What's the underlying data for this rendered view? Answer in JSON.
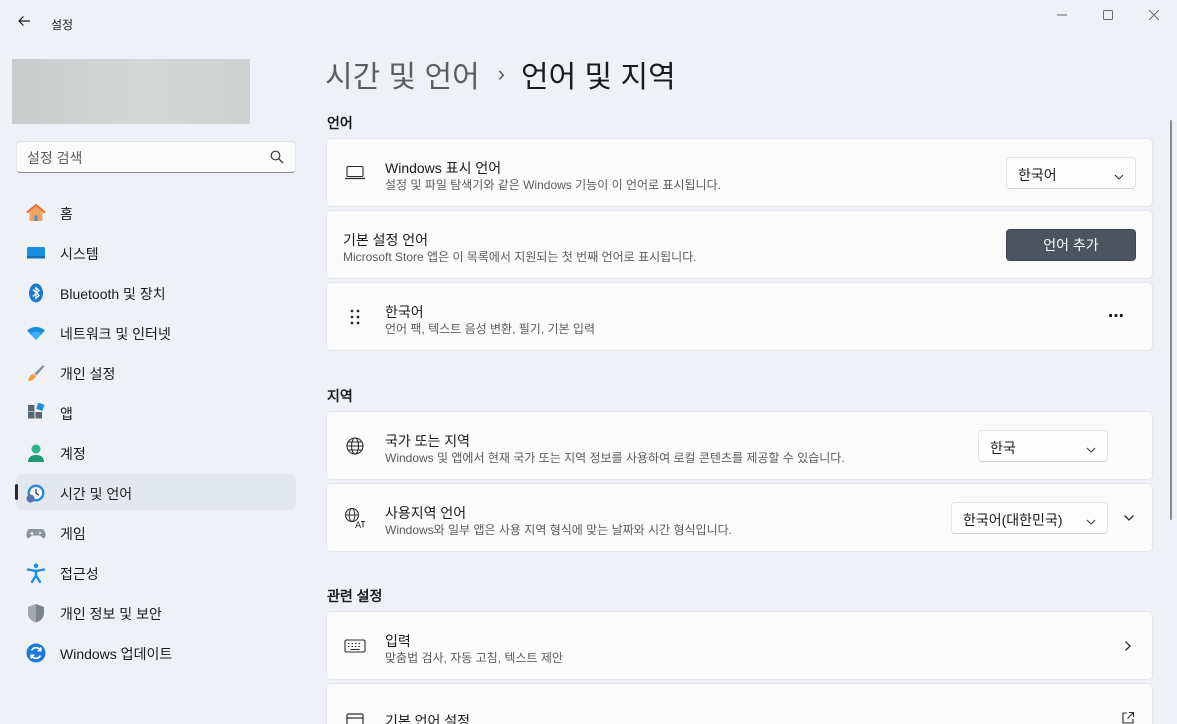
{
  "window": {
    "app_title": "설정",
    "icons": {
      "back": "back-arrow-icon",
      "minimize": "minimize-icon",
      "maximize": "maximize-icon",
      "close": "close-icon"
    }
  },
  "sidebar": {
    "search_placeholder": "설정 검색",
    "items": [
      {
        "label": "홈",
        "icon": "home-icon",
        "active": false
      },
      {
        "label": "시스템",
        "icon": "system-icon",
        "active": false
      },
      {
        "label": "Bluetooth 및 장치",
        "icon": "bluetooth-icon",
        "active": false
      },
      {
        "label": "네트워크 및 인터넷",
        "icon": "wifi-icon",
        "active": false
      },
      {
        "label": "개인 설정",
        "icon": "brush-icon",
        "active": false
      },
      {
        "label": "앱",
        "icon": "apps-icon",
        "active": false
      },
      {
        "label": "계정",
        "icon": "account-icon",
        "active": false
      },
      {
        "label": "시간 및 언어",
        "icon": "time-language-icon",
        "active": true
      },
      {
        "label": "게임",
        "icon": "gamepad-icon",
        "active": false
      },
      {
        "label": "접근성",
        "icon": "accessibility-icon",
        "active": false
      },
      {
        "label": "개인 정보 및 보안",
        "icon": "shield-icon",
        "active": false
      },
      {
        "label": "Windows 업데이트",
        "icon": "windows-update-icon",
        "active": false
      }
    ]
  },
  "breadcrumb": {
    "parent": "시간 및 언어",
    "separator": "›",
    "current": "언어 및 지역"
  },
  "sections": {
    "language": "언어",
    "region": "지역",
    "related": "관련 설정"
  },
  "cards": {
    "display_language": {
      "title": "Windows 표시 언어",
      "desc": "설정 및 파일 탐색기와 같은 Windows 기능이 이 언어로 표시됩니다.",
      "value": "한국어"
    },
    "preferred_language": {
      "title": "기본 설정 언어",
      "desc": "Microsoft Store 앱은 이 목록에서 지원되는 첫 번째 언어로 표시됩니다.",
      "button": "언어 추가"
    },
    "korean": {
      "title": "한국어",
      "desc": "언어 팩, 텍스트 음성 변환, 필기, 기본 입력",
      "more": "⋯"
    },
    "country": {
      "title": "국가 또는 지역",
      "desc": "Windows 및 앱에서 현재 국가 또는 지역 정보를 사용하여 로컬 콘텐츠를 제공할 수 있습니다.",
      "value": "한국"
    },
    "regional_format": {
      "title": "사용지역 언어",
      "desc": "Windows와 일부 앱은 사용 지역 형식에 맞는 날짜와 시간 형식입니다.",
      "value": "한국어(대한민국)"
    },
    "typing": {
      "title": "입력",
      "desc": "맞춤법 검사, 자동 고침, 텍스트 제안"
    },
    "admin_language": {
      "title": "기본 언어 설정"
    }
  },
  "colors": {
    "background": "#eef2f7",
    "card": "#fbfbfc",
    "primary_button": "#4b5561",
    "accent_blue": "#0a63c9"
  }
}
